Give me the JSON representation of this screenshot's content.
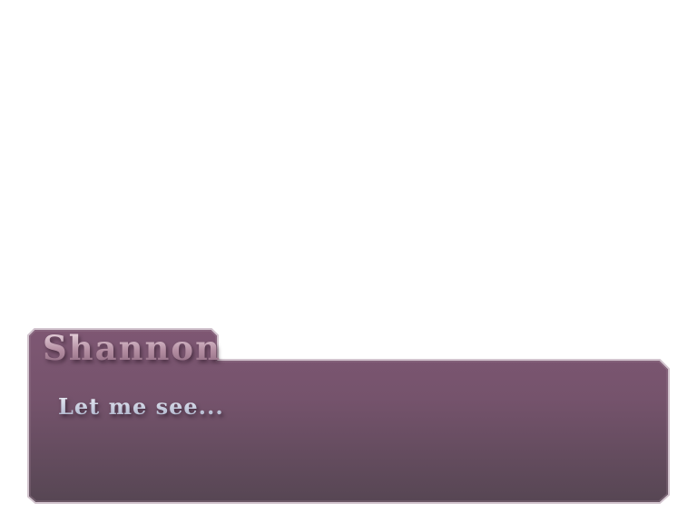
{
  "dialogue": {
    "speaker": "Shannon",
    "text": "Let me see..."
  },
  "colors": {
    "box_top": "#7d5672",
    "box_bottom": "#584855",
    "box_border": "#cfc2cc",
    "background": "#ffffff"
  }
}
